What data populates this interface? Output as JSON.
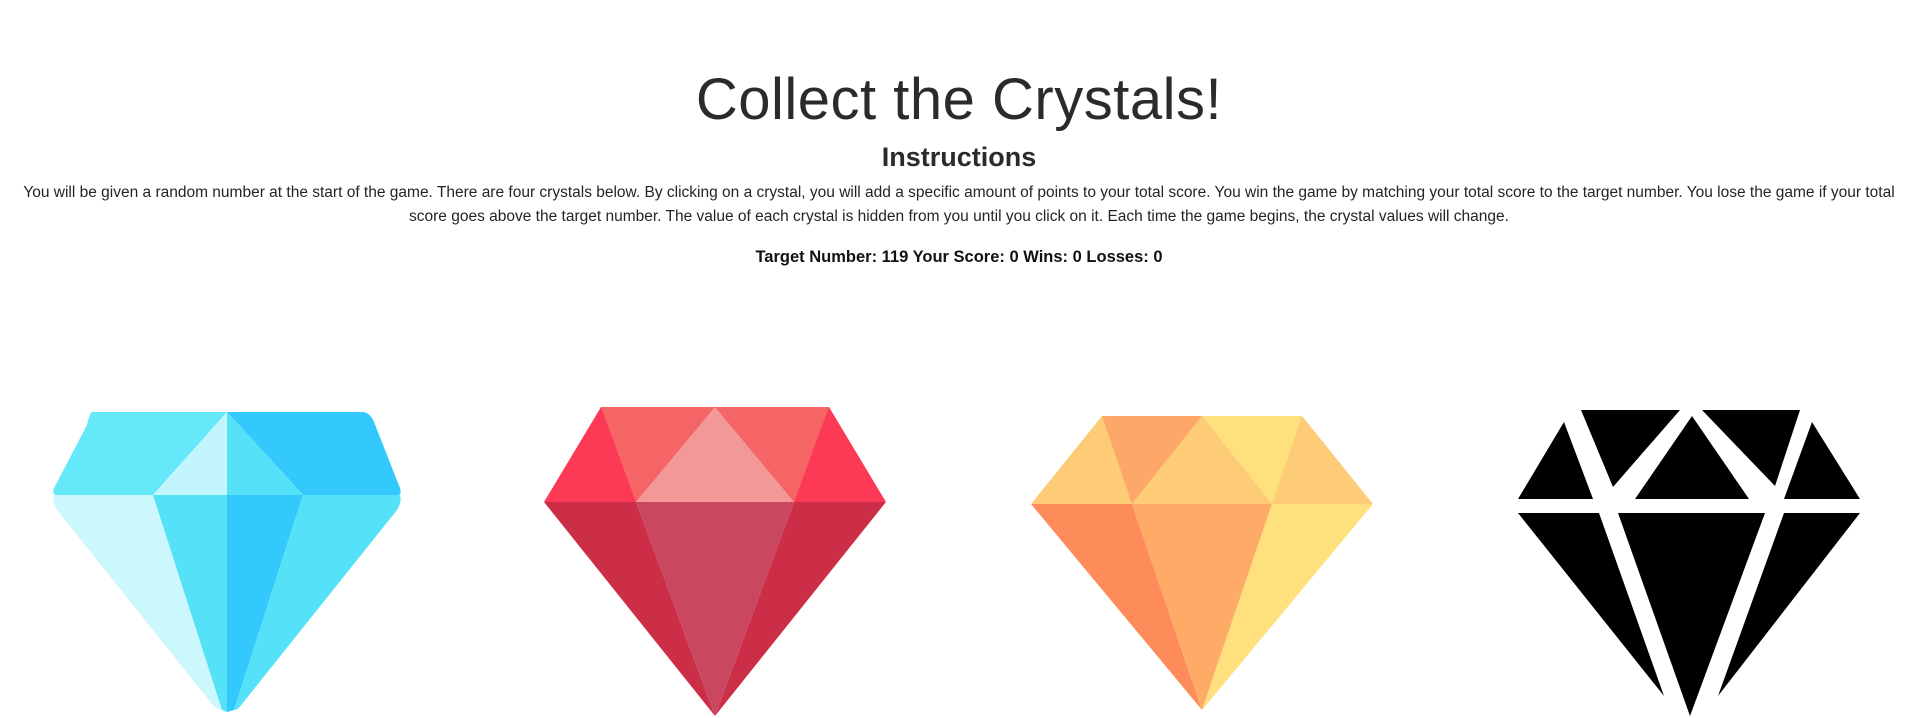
{
  "header": {
    "title": "Collect the Crystals!",
    "subtitle": "Instructions"
  },
  "instructions": {
    "text": "You will be given a random number at the start of the game. There are four crystals below. By clicking on a crystal, you will add a specific amount of points to your total score. You win the game by matching your total score to the target number. You lose the game if your total score goes above the target number. The value of each crystal is hidden from you until you click on it. Each time the game begins, the crystal values will change."
  },
  "scoreboard": {
    "target_label": "Target Number:",
    "target_value": "119",
    "score_label": "Your Score:",
    "score_value": "0",
    "wins_label": "Wins:",
    "wins_value": "0",
    "losses_label": "Losses:",
    "losses_value": "0"
  },
  "crystals": [
    {
      "name": "blue-crystal-icon",
      "colors": [
        "#66e8fb",
        "#34c9fc",
        "#ccf7fc",
        "#55e2f9",
        "#c2f5fd"
      ]
    },
    {
      "name": "red-crystal-icon",
      "colors": [
        "#fd3a55",
        "#f66565",
        "#f29898",
        "#cc2d47",
        "#c94860"
      ]
    },
    {
      "name": "orange-crystal-icon",
      "colors": [
        "#fecc77",
        "#fda868",
        "#fee07c",
        "#fe8c5a",
        "#feab67"
      ]
    },
    {
      "name": "black-crystal-icon",
      "colors": [
        "#000000",
        "#ffffff"
      ]
    }
  ]
}
